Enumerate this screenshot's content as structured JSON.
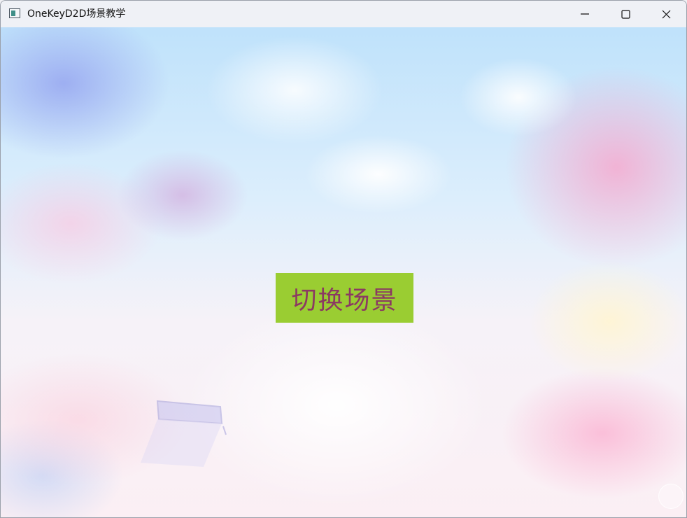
{
  "window": {
    "title": "OneKeyD2D场景教学",
    "icon": "app-window-icon",
    "controls": {
      "minimize_icon": "minimize-icon",
      "maximize_icon": "maximize-icon",
      "close_icon": "close-icon"
    }
  },
  "scene": {
    "background": "pastel-sky-clouds",
    "button": {
      "label": "切换场景",
      "background_color": "#9acd32",
      "text_color": "#8b3a62"
    }
  }
}
